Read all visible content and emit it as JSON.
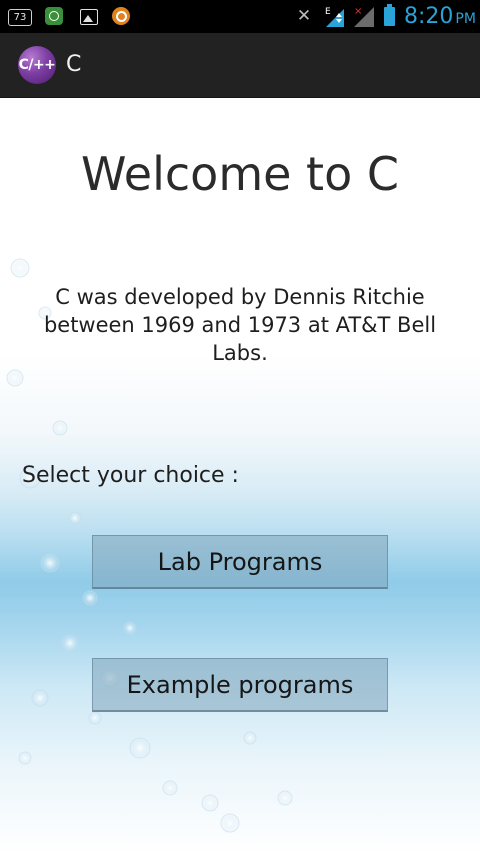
{
  "status_bar": {
    "notification_badge": "73",
    "time": "8:20",
    "ampm": "PM",
    "icons": [
      "notification-count-icon",
      "green-app-icon",
      "gallery-icon",
      "orange-app-icon",
      "mute-icon",
      "signal-e-icon",
      "signal-bars-icon",
      "battery-icon"
    ],
    "accent_color": "#29a3d8"
  },
  "action_bar": {
    "app_icon_text": "C/++",
    "title": "C",
    "background": "#222222"
  },
  "main": {
    "heading": "Welcome to C",
    "description": "C was developed by Dennis Ritchie between 1969 and 1973 at AT&T Bell Labs.",
    "select_label": "Select your choice :",
    "buttons": [
      {
        "label": "Lab Programs"
      },
      {
        "label": "Example programs"
      }
    ]
  }
}
